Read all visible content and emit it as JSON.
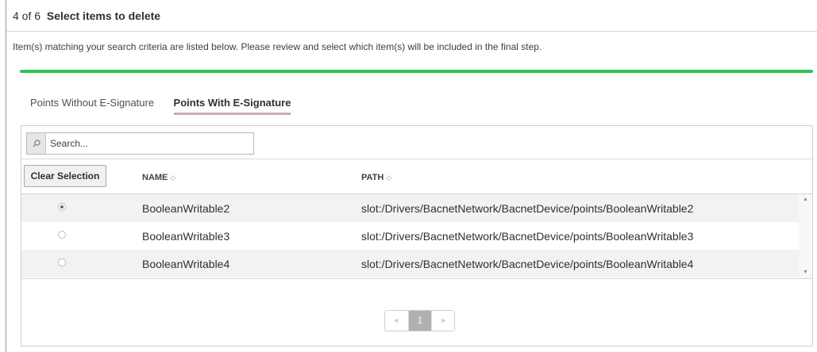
{
  "step": {
    "count": "4 of 6",
    "title": "Select items to delete"
  },
  "description": "Item(s) matching your search criteria are listed below. Please review and select which item(s) will be included in the final step.",
  "progress": {
    "fraction": 1.0,
    "color": "#2fc54d"
  },
  "tabs": [
    {
      "label": "Points Without E-Signature",
      "active": false
    },
    {
      "label": "Points With E-Signature",
      "active": true
    }
  ],
  "search": {
    "placeholder": "Search...",
    "value": "",
    "icon": "search-icon"
  },
  "table": {
    "clear_label": "Clear Selection",
    "columns": [
      {
        "label": "NAME",
        "sort_icon": "◇"
      },
      {
        "label": "PATH",
        "sort_icon": "◇"
      }
    ],
    "rows": [
      {
        "selected": true,
        "name": "BooleanWritable2",
        "path": "slot:/Drivers/BacnetNetwork/BacnetDevice/points/BooleanWritable2"
      },
      {
        "selected": false,
        "name": "BooleanWritable3",
        "path": "slot:/Drivers/BacnetNetwork/BacnetDevice/points/BooleanWritable3"
      },
      {
        "selected": false,
        "name": "BooleanWritable4",
        "path": "slot:/Drivers/BacnetNetwork/BacnetDevice/points/BooleanWritable4"
      }
    ]
  },
  "pagination": {
    "prev": "«",
    "current": "1",
    "next": "»"
  },
  "scroll": {
    "up": "▲",
    "down": "▼"
  }
}
